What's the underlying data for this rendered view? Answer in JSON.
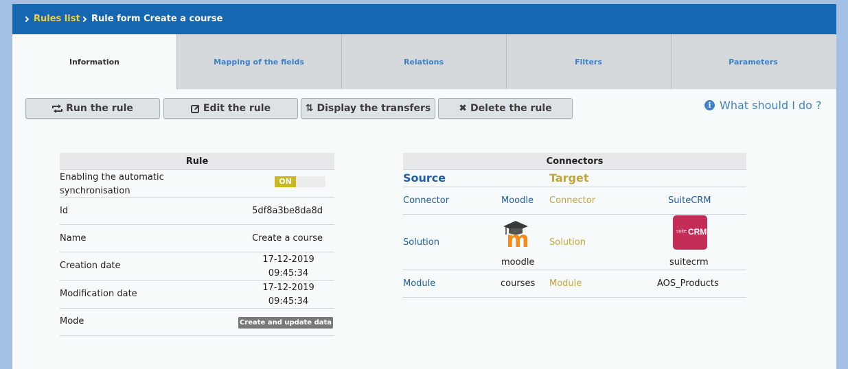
{
  "breadcrumb": {
    "root": "Rules list",
    "current": "Rule form Create a course"
  },
  "tabs": [
    {
      "label": "Information",
      "active": true
    },
    {
      "label": "Mapping of the fields",
      "active": false
    },
    {
      "label": "Relations",
      "active": false
    },
    {
      "label": "Filters",
      "active": false
    },
    {
      "label": "Parameters",
      "active": false
    }
  ],
  "actions": {
    "run": "Run the rule",
    "edit": "Edit the rule",
    "display": "Display the transfers",
    "delete": "Delete the rule",
    "help": "What should I do ?"
  },
  "rule": {
    "title": "Rule",
    "rows": {
      "sync": {
        "label": "Enabling the automatic synchronisation",
        "value": "ON"
      },
      "id": {
        "label": "Id",
        "value": "5df8a3be8da8d"
      },
      "name": {
        "label": "Name",
        "value": "Create a course"
      },
      "created": {
        "label": "Creation date",
        "value": "17-12-2019 09:45:34"
      },
      "modified": {
        "label": "Modification date",
        "value": "17-12-2019 09:45:34"
      },
      "mode": {
        "label": "Mode",
        "value": "Create and update data"
      }
    }
  },
  "connectors": {
    "title": "Connectors",
    "source": {
      "heading": "Source",
      "connector_label": "Connector",
      "connector": "Moodle",
      "solution_label": "Solution",
      "solution": "moodle",
      "module_label": "Module",
      "module": "courses"
    },
    "target": {
      "heading": "Target",
      "connector_label": "Connector",
      "connector": "SuiteCRM",
      "solution_label": "Solution",
      "solution": "suitecrm",
      "module_label": "Module",
      "module": "AOS_Products"
    }
  },
  "logos": {
    "moodle_letter": "m",
    "suitecrm_prefix": "suite",
    "suitecrm_mark": "CRM"
  },
  "colors": {
    "header": "#1667b2",
    "breadcrumb_link": "#f0d23e",
    "source": "#1e5ea6",
    "target": "#c1a73b",
    "toggle_on": "#c8b920"
  }
}
